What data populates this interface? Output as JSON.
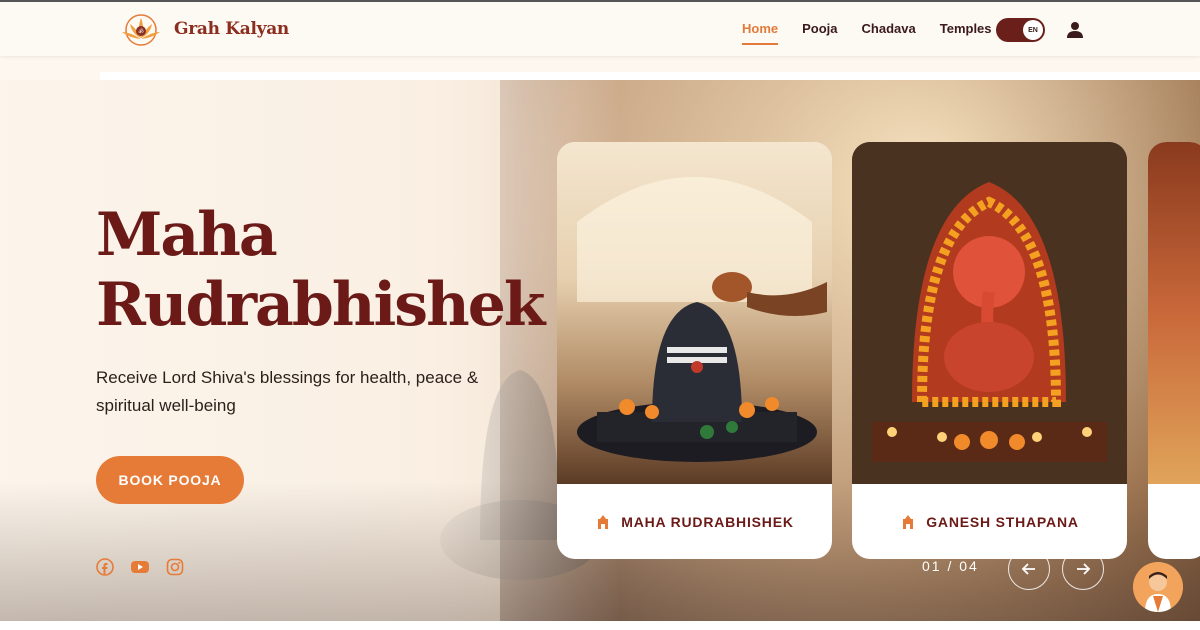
{
  "brand": {
    "name": "Grah Kalyan"
  },
  "nav": {
    "items": [
      {
        "label": "Home",
        "active": true
      },
      {
        "label": "Pooja",
        "active": false
      },
      {
        "label": "Chadava",
        "active": false
      },
      {
        "label": "Temples",
        "active": false
      }
    ],
    "language_toggle": "EN"
  },
  "hero": {
    "title_line1": "Maha",
    "title_line2": "Rudrabhishek",
    "subtitle": "Receive Lord Shiva's blessings for health, peace & spiritual well-being",
    "cta": "BOOK POOJA",
    "socials": [
      "facebook-icon",
      "youtube-icon",
      "instagram-icon"
    ]
  },
  "carousel": {
    "cards": [
      {
        "label": "MAHA RUDRABHISHEK"
      },
      {
        "label": "GANESH STHAPANA"
      },
      {
        "label": ""
      }
    ],
    "counter": "01 / 04"
  },
  "colors": {
    "accent": "#e67b38",
    "maroon": "#6b1a17",
    "background": "#fdf7ef"
  }
}
